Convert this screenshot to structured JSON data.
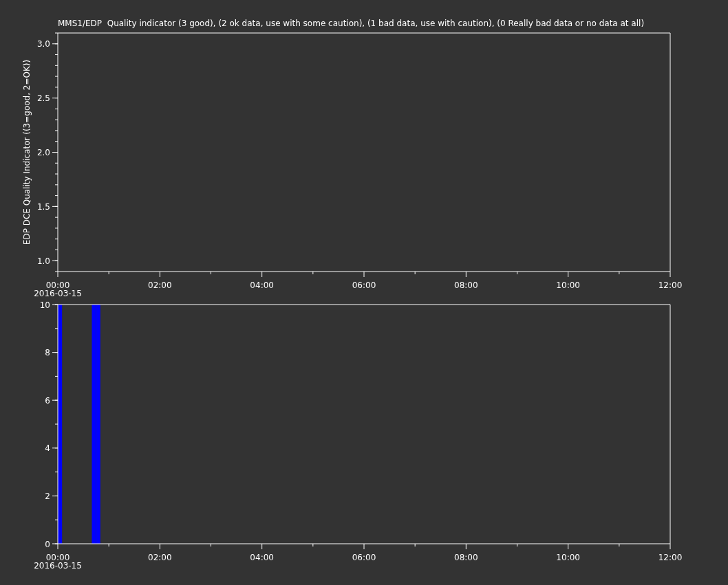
{
  "panels": [
    {
      "chart_data": {
        "type": "line",
        "title": "MMS1/EDP  Quality indicator (3 good), (2 ok data, use with some caution), (1 bad data, use with caution), (0 Really bad data or no data at all)",
        "ylabel": "EDP DCE Quality Indicator ((3=good, 2=OK))",
        "xlim": [
          0,
          12
        ],
        "ylim": [
          0.9,
          3.1
        ],
        "xticks": [
          {
            "value": 0,
            "label": "00:00"
          },
          {
            "value": 2,
            "label": "02:00"
          },
          {
            "value": 4,
            "label": "04:00"
          },
          {
            "value": 6,
            "label": "06:00"
          },
          {
            "value": 8,
            "label": "08:00"
          },
          {
            "value": 10,
            "label": "10:00"
          },
          {
            "value": 12,
            "label": "12:00"
          }
        ],
        "yticks": [
          {
            "value": 1,
            "label": "1.0"
          },
          {
            "value": 1.5,
            "label": "1.5"
          },
          {
            "value": 2,
            "label": "2.0"
          },
          {
            "value": 2.5,
            "label": "2.5"
          },
          {
            "value": 3,
            "label": "3.0"
          }
        ]
      },
      "date_label": "2016-03-15"
    },
    {
      "chart_data": {
        "type": "bar",
        "x": [
          0,
          0.6667,
          0.75
        ],
        "values": [
          10,
          10,
          10
        ],
        "xlim": [
          0,
          12
        ],
        "ylim": [
          0,
          10
        ],
        "xticks": [
          {
            "value": 0,
            "label": "00:00"
          },
          {
            "value": 2,
            "label": "02:00"
          },
          {
            "value": 4,
            "label": "04:00"
          },
          {
            "value": 6,
            "label": "06:00"
          },
          {
            "value": 8,
            "label": "08:00"
          },
          {
            "value": 10,
            "label": "10:00"
          },
          {
            "value": 12,
            "label": "12:00"
          }
        ],
        "yticks": [
          {
            "value": 0,
            "label": "0"
          },
          {
            "value": 2,
            "label": "2"
          },
          {
            "value": 4,
            "label": "4"
          },
          {
            "value": 6,
            "label": "6"
          },
          {
            "value": 8,
            "label": "8"
          },
          {
            "value": 10,
            "label": "10"
          }
        ]
      },
      "date_label": "2016-03-15"
    }
  ]
}
